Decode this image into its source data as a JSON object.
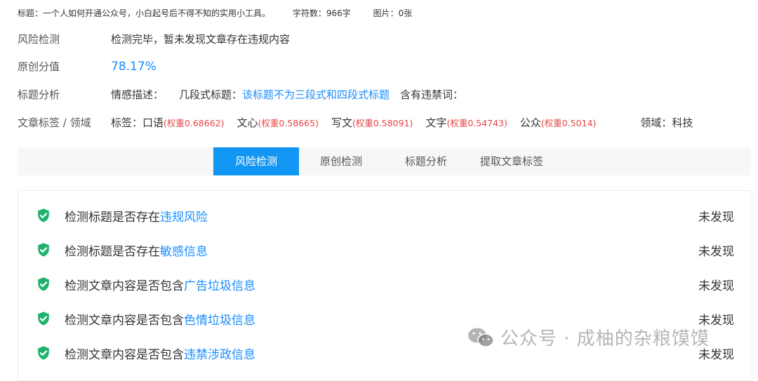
{
  "topline": {
    "title": "标题：一个人如何开通公众号，小白起号后不得不知的实用小工具。",
    "chars": "字符数：966字",
    "images": "图片：0张"
  },
  "risk": {
    "label": "风险检测",
    "value": "检测完毕，暂未发现文章存在违规内容"
  },
  "original": {
    "label": "原创分值",
    "value": "78.17%"
  },
  "title_analysis": {
    "label": "标题分析",
    "emotion_label": "情感描述：",
    "segment_label": "几段式标题：",
    "segment_value": "该标题不为三段式和四段式标题",
    "banned_label": "含有违禁词："
  },
  "tags": {
    "label": "文章标签 / 领域",
    "prefix": "标签：",
    "items": [
      {
        "word": "口语",
        "weight": "(权重0.68662)"
      },
      {
        "word": "文心",
        "weight": "(权重0.58665)"
      },
      {
        "word": "写文",
        "weight": "(权重0.58091)"
      },
      {
        "word": "文字",
        "weight": "(权重0.54743)"
      },
      {
        "word": "公众",
        "weight": "(权重0.5014)"
      }
    ],
    "domain": "领域：科技"
  },
  "tabs": [
    "风险检测",
    "原创检测",
    "标题分析",
    "提取文章标签"
  ],
  "active_tab": "风险检测",
  "checks": [
    {
      "text": "检测标题是否存在",
      "highlight": "违规风险",
      "result": "未发现"
    },
    {
      "text": "检测标题是否存在",
      "highlight": "敏感信息",
      "result": "未发现"
    },
    {
      "text": "检测文章内容是否包含",
      "highlight": "广告垃圾信息",
      "result": "未发现"
    },
    {
      "text": "检测文章内容是否包含",
      "highlight": "色情垃圾信息",
      "result": "未发现"
    },
    {
      "text": "检测文章内容是否包含",
      "highlight": "违禁涉政信息",
      "result": "未发现"
    }
  ],
  "watermark": "公众号 · 成柚的杂粮馍馍",
  "colors": {
    "accent": "#1296f3",
    "link": "#1a8cff",
    "weight": "#e64343",
    "shield": "#1fb26b"
  },
  "icons": {
    "check": "shield-check-icon",
    "watermark": "wechat-icon"
  }
}
